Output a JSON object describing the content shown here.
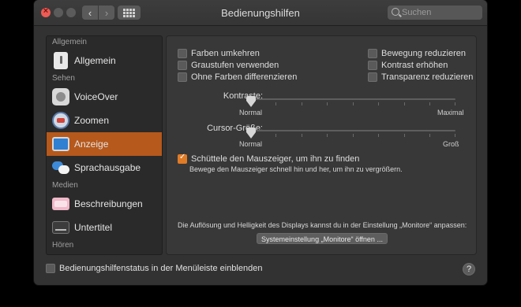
{
  "window": {
    "title": "Bedienungshilfen"
  },
  "toolbar": {
    "back_glyph": "‹",
    "forward_glyph": "›",
    "search_placeholder": "Suchen"
  },
  "sidebar": {
    "sections": [
      {
        "label": "Allgemein"
      },
      {
        "label": "Sehen"
      },
      {
        "label": "Medien"
      },
      {
        "label": "Hören"
      }
    ],
    "items": [
      {
        "label": "Allgemein",
        "icon": "general-icon"
      },
      {
        "label": "VoiceOver",
        "icon": "voiceover-icon"
      },
      {
        "label": "Zoomen",
        "icon": "zoom-icon"
      },
      {
        "label": "Anzeige",
        "icon": "display-icon",
        "selected": true
      },
      {
        "label": "Sprachausgabe",
        "icon": "speech-icon"
      },
      {
        "label": "Beschreibungen",
        "icon": "descriptions-icon"
      },
      {
        "label": "Untertitel",
        "icon": "captions-icon"
      }
    ]
  },
  "display": {
    "checkboxes": [
      {
        "label": "Farben umkehren",
        "checked": false
      },
      {
        "label": "Graustufen verwenden",
        "checked": false
      },
      {
        "label": "Ohne Farben differenzieren",
        "checked": false
      },
      {
        "label": "Bewegung reduzieren",
        "checked": false
      },
      {
        "label": "Kontrast erhöhen",
        "checked": false
      },
      {
        "label": "Transparenz reduzieren",
        "checked": false
      }
    ],
    "contrast": {
      "label": "Kontraste:",
      "min_label": "Normal",
      "max_label": "Maximal",
      "value": 0
    },
    "cursor": {
      "label": "Cursor-Größe:",
      "min_label": "Normal",
      "max_label": "Groß",
      "value": 0
    },
    "shake": {
      "label": "Schüttele den Mauszeiger, um ihn zu finden",
      "checked": true,
      "description": "Bewege den Mauszeiger schnell hin und her, um ihn zu vergrößern."
    },
    "monitors_note": "Die Auflösung und Helligkeit des Displays kannst du in der Einstellung „Monitore“ anpassen:",
    "monitors_button": "Systemeinstellung „Monitore“ öffnen ..."
  },
  "footer": {
    "status_checkbox": "Bedienungshilfenstatus in der Menüleiste einblenden",
    "status_checked": false,
    "help": "?"
  },
  "colors": {
    "accent": "#b6591c",
    "checkbox_on": "#e07b26"
  }
}
